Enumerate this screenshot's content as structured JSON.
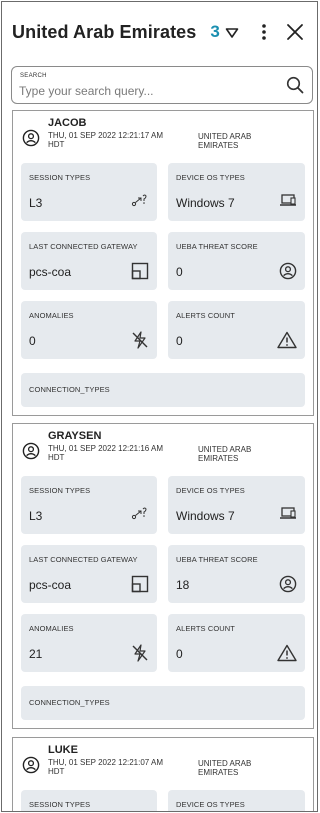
{
  "header": {
    "title": "United Arab Emirates",
    "count": "3",
    "filter_icon": "filter-triangle-icon",
    "menu_icon": "kebab-menu-icon",
    "close_icon": "close-icon"
  },
  "search": {
    "label": "SEARCH",
    "placeholder": "Type your search query..."
  },
  "labels": {
    "session_types": "SESSION TYPES",
    "device_os_types": "DEVICE OS TYPES",
    "last_gateway": "LAST CONNECTED GATEWAY",
    "ueba_score": "UEBA THREAT SCORE",
    "anomalies": "ANOMALIES",
    "alerts_count": "ALERTS COUNT",
    "connection_types": "CONNECTION_TYPES"
  },
  "cards": [
    {
      "name": "JACOB",
      "time_line1": "THU, 01 SEP 2022 12:21:17 AM",
      "time_line2": "HDT",
      "loc_line1": "UNITED ARAB",
      "loc_line2": "EMIRATES",
      "session_types": "L3",
      "device_os": "Windows 7",
      "gateway": "pcs-coa",
      "ueba_score": "0",
      "anomalies": "0",
      "alerts_count": "0"
    },
    {
      "name": "GRAYSEN",
      "time_line1": "THU, 01 SEP 2022 12:21:16 AM",
      "time_line2": "HDT",
      "loc_line1": "UNITED ARAB",
      "loc_line2": "EMIRATES",
      "session_types": "L3",
      "device_os": "Windows 7",
      "gateway": "pcs-coa",
      "ueba_score": "18",
      "anomalies": "21",
      "alerts_count": "0"
    },
    {
      "name": "LUKE",
      "time_line1": "THU, 01 SEP 2022 12:21:07 AM",
      "time_line2": "HDT",
      "loc_line1": "UNITED ARAB",
      "loc_line2": "EMIRATES"
    }
  ],
  "colors": {
    "accent": "#1a8fb0",
    "tile_bg": "#e6eaee",
    "border": "#9a9a9a"
  }
}
